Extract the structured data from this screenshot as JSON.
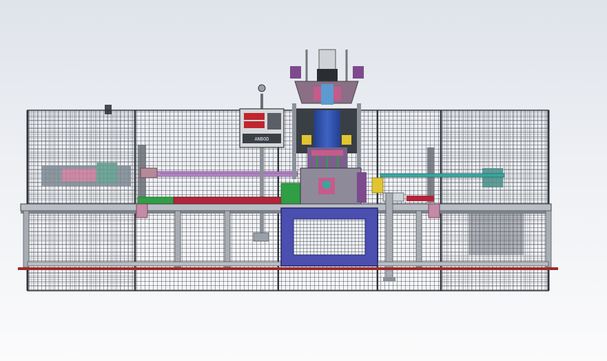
{
  "scene": {
    "description_visible_text": "",
    "control_panel": {
      "display_1": "",
      "display_2": "",
      "brand_label": "ANBOD"
    },
    "colors": {
      "background_top": "#dfe3ea",
      "background_bottom": "#fbfbfc",
      "fence_mesh": "#3b3f46",
      "frame_grey": "#9aa0a8",
      "base_rail": "#9b2b2b",
      "press_blue": "#2f4ea8",
      "window_panel": "#4a4fb0",
      "conveyor_green": "#2f9e44",
      "conveyor_red": "#b4233a",
      "pipe_pink": "#b68ac6",
      "pipe_teal": "#3aa6a0",
      "accent_yellow": "#e1c431"
    }
  }
}
